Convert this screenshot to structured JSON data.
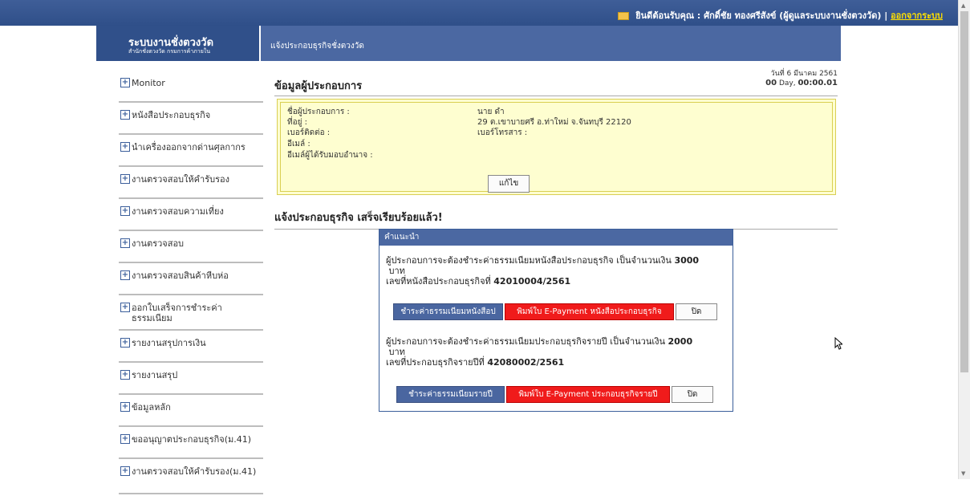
{
  "topbar": {
    "welcome": "ยินดีต้อนรับคุณ : ศักดิ์ชัย ทองศรีสังข์ (ผู้ดูแลระบบงานชั่งตวงวัด) |",
    "logout": "ออกจากระบบ"
  },
  "brand": {
    "title": "ระบบงานชั่งตวงวัด",
    "subtitle": "สำนักชั่งตวงวัด กรมการค้าภายใน"
  },
  "pagebar": {
    "title": "แจ้งประกอบธุรกิจชั่งตวงวัด"
  },
  "sidebar": {
    "items": [
      "Monitor",
      "หนังสือประกอบธุรกิจ",
      "นำเครื่องออกจากด่านศุลกากร",
      "งานตรวจสอบให้คำรับรอง",
      "งานตรวจสอบความเที่ยง",
      "งานตรวจสอบ",
      "งานตรวจสอบสินค้าหีบห่อ",
      "ออกใบเสร็จการชำระค่าธรรมเนียม",
      "รายงานสรุปการเงิน",
      "รายงานสรุป",
      "ข้อมูลหลัก",
      "ขออนุญาตประกอบธุรกิจ(ม.41)",
      "งานตรวจสอบให้คำรับรอง(ม.41)"
    ]
  },
  "main": {
    "title": "ข้อมูลผู้ประกอบการ",
    "date": "วันที่ 6 มีนาคม 2561",
    "timer_day": "00",
    "timer_rest": "Day,",
    "timer_time": "00:00.01",
    "info": {
      "name_label": "ชื่อผู้ประกอบการ :",
      "name_value": "นาย ดำ",
      "address_label": "ที่อยู่ :",
      "address_value": "29 ต.เขาบายศรี อ.ท่าใหม่ จ.จันทบุรี 22120",
      "phone_label": "เบอร์ติดต่อ :",
      "fax_label": "เบอร์โทรสาร :",
      "email_label": "อีเมล์ :",
      "delegate_email_label": "อีเมล์ผู้ได้รับมอบอำนาจ :",
      "edit_button": "แก้ไข"
    },
    "success_message": "แจ้งประกอบธุรกิจ เสร็จเรียบร้อยแล้ว!"
  },
  "dialog": {
    "header": "คำแนะนำ",
    "section1": {
      "line1": "ผู้ประกอบการจะต้องชำระค่าธรรมเนียมหนังสือประกอบธุรกิจ เป็นจำนวนเงิน",
      "amount": "3000",
      "unit": "บาท",
      "line2": "เลขที่หนังสือประกอบธุรกิจที่",
      "number": "42010004/2561",
      "btn_pay": "ชำระค่าธรรมเนียมหนังสือป",
      "btn_print": "พิมพ์ใบ E-Payment หนังสือประกอบธุรกิจ",
      "btn_close": "ปิด"
    },
    "section2": {
      "line1": "ผู้ประกอบการจะต้องชำระค่าธรรมเนียมประกอบธุรกิจรายปี เป็นจำนวนเงิน",
      "amount": "2000",
      "unit": "บาท",
      "line2": "เลขที่ประกอบธุรกิจรายปีที่",
      "number": "42080002/2561",
      "btn_pay": "ชำระค่าธรรมเนียมรายปี",
      "btn_print": "พิมพ์ใบ E-Payment ประกอบธุรกิจรายปี",
      "btn_close": "ปิด"
    }
  },
  "colors": {
    "header_blue": "#30508a",
    "pay_button": "#4a66a0",
    "print_button": "#f01b1b",
    "info_bg": "#fefed0"
  }
}
